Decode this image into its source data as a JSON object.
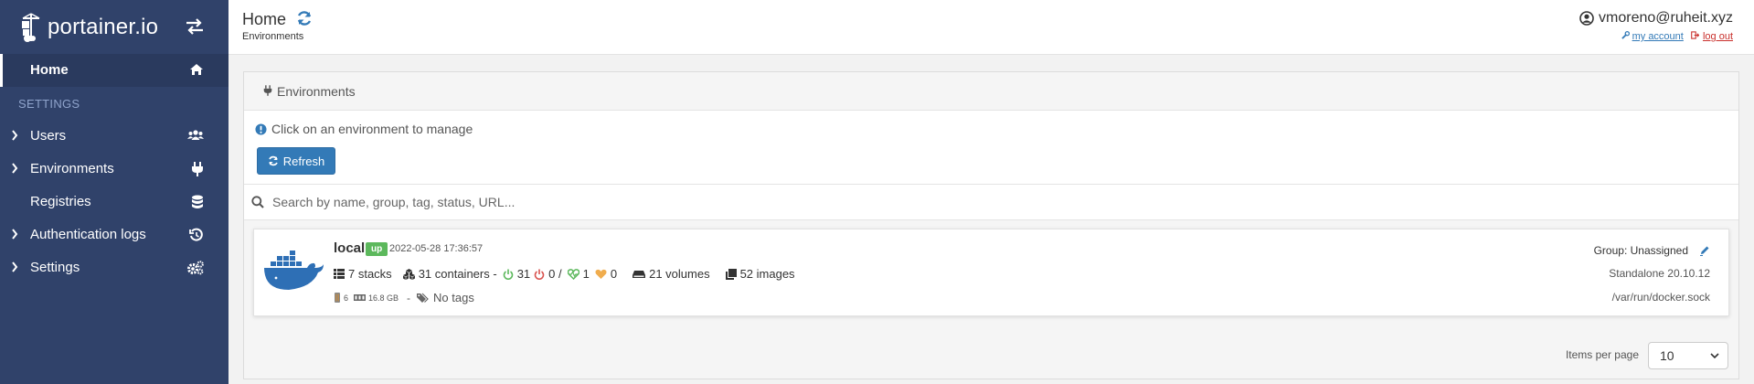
{
  "app": {
    "logo_text": "portainer.io"
  },
  "sidebar": {
    "home": "Home",
    "section_title": "SETTINGS",
    "items": [
      {
        "label": "Users",
        "icon": "users-icon"
      },
      {
        "label": "Environments",
        "icon": "plug-icon"
      },
      {
        "label": "Registries",
        "icon": "database-icon"
      },
      {
        "label": "Authentication logs",
        "icon": "history-icon"
      },
      {
        "label": "Settings",
        "icon": "cogs-icon"
      }
    ]
  },
  "header": {
    "title": "Home",
    "subtitle": "Environments",
    "user": "vmoreno@ruheit.xyz",
    "my_account": "my account",
    "log_out": "log out"
  },
  "panel": {
    "title": "Environments",
    "info": "Click on an environment to manage",
    "refresh_button": "Refresh",
    "search_placeholder": "Search by name, group, tag, status, URL..."
  },
  "environment": {
    "name": "local",
    "status": "up",
    "timestamp": "2022-05-28 17:36:57",
    "stacks": "7 stacks",
    "containers": "31 containers -",
    "running": "31",
    "stopped": "0 /",
    "healthy": "1",
    "unhealthy": "0",
    "volumes": "21 volumes",
    "images": "52 images",
    "cpu": "6",
    "memory": "16.8 GB",
    "separator": "-",
    "tags": "No tags",
    "group": "Group: Unassigned",
    "type": "Standalone 20.10.12",
    "url": "/var/run/docker.sock"
  },
  "pagination": {
    "label": "Items per page",
    "value": "10"
  },
  "colors": {
    "sidebar": "#30426a",
    "primary": "#337ab7",
    "up": "#5cb85c",
    "docker": "#2e6fb5"
  }
}
